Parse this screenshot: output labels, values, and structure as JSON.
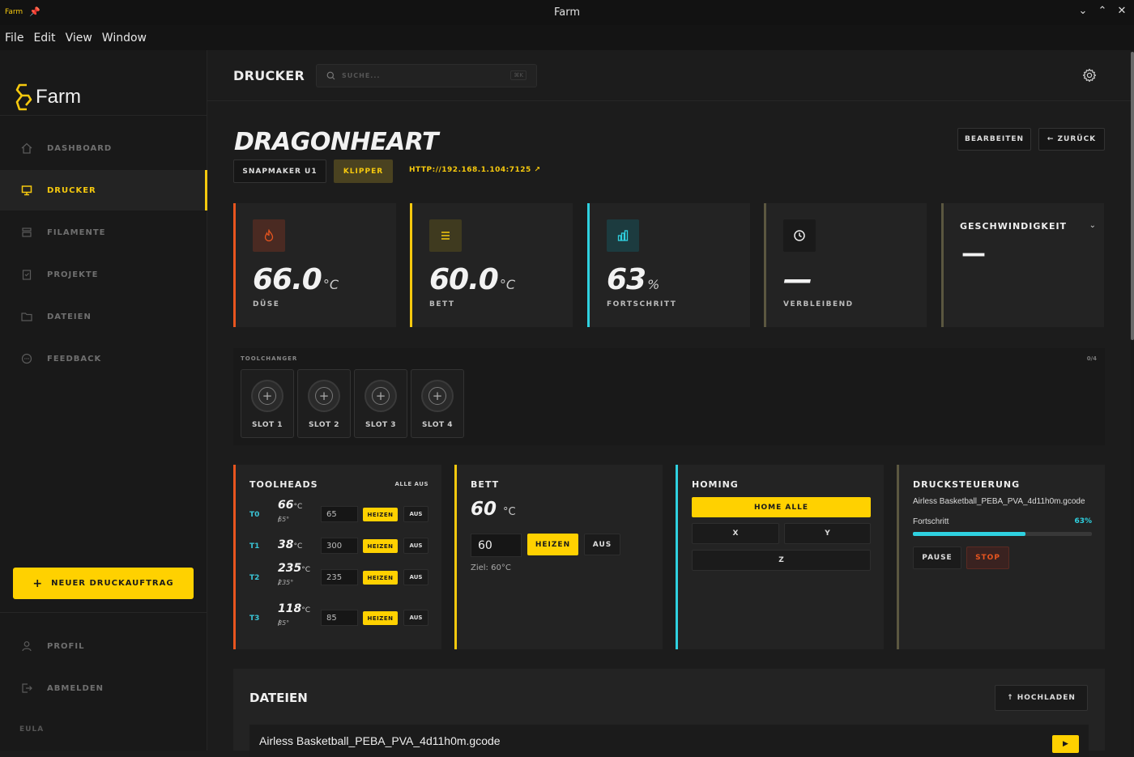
{
  "window": {
    "app_logo": "Farm",
    "title": "Farm",
    "controls": [
      "minimize",
      "maximize",
      "close"
    ]
  },
  "menu": [
    "File",
    "Edit",
    "View",
    "Window"
  ],
  "brand": {
    "name": "Farm"
  },
  "nav": [
    {
      "label": "DASHBOARD",
      "icon": "home-icon"
    },
    {
      "label": "DRUCKER",
      "icon": "monitor-icon",
      "active": true
    },
    {
      "label": "FILAMENTE",
      "icon": "layers-icon"
    },
    {
      "label": "PROJEKTE",
      "icon": "clipboard-icon"
    },
    {
      "label": "DATEIEN",
      "icon": "folder-icon"
    },
    {
      "label": "FEEDBACK",
      "icon": "chat-icon"
    }
  ],
  "new_job_label": "NEUER DRUCKAUFTRAG",
  "profile_label": "PROFIL",
  "logout_label": "ABMELDEN",
  "eula_label": "EULA",
  "header": {
    "title": "DRUCKER",
    "search_placeholder": "SUCHE...",
    "search_shortcut": "⌘K"
  },
  "printer": {
    "name": "DRAGONHEART",
    "model": "SNAPMAKER U1",
    "firmware": "KLIPPER",
    "url": "HTTP://192.168.1.104:7125",
    "edit_label": "BEARBEITEN",
    "back_label": "← ZURÜCK"
  },
  "stats": [
    {
      "value": "66.0",
      "unit": "°C",
      "label": "DÜSE",
      "color": "#e8551f"
    },
    {
      "value": "60.0",
      "unit": "°C",
      "label": "BETT",
      "color": "#f6c90e"
    },
    {
      "value": "63",
      "unit": "%",
      "label": "FORTSCHRITT",
      "color": "#2fd1e0"
    },
    {
      "value": "—",
      "unit": "",
      "label": "VERBLEIBEND",
      "color": "#5b5740"
    }
  ],
  "speed": {
    "title": "GESCHWINDIGKEIT",
    "value": "—"
  },
  "toolchanger": {
    "title": "TOOLCHANGER",
    "count": "0/4",
    "slots": [
      "SLOT 1",
      "SLOT 2",
      "SLOT 3",
      "SLOT 4"
    ]
  },
  "toolheads": {
    "title": "TOOLHEADS",
    "all_off": "ALLE AUS",
    "heat_label": "HEIZEN",
    "off_label": "AUS",
    "unit": "°C /",
    "rows": [
      {
        "id": "T0",
        "temp": "66",
        "target": "65°",
        "input": "65"
      },
      {
        "id": "T1",
        "temp": "38",
        "target": "",
        "input": "300"
      },
      {
        "id": "T2",
        "temp": "235",
        "target": "235°",
        "input": "235"
      },
      {
        "id": "T3",
        "temp": "118",
        "target": "85°",
        "input": "85"
      }
    ]
  },
  "bed_panel": {
    "title": "BETT",
    "temp": "60",
    "unit": "°C",
    "input": "60",
    "heat": "HEIZEN",
    "off": "AUS",
    "target": "Ziel: 60°C"
  },
  "homing": {
    "title": "HOMING",
    "home_all": "HOME ALLE",
    "x": "X",
    "y": "Y",
    "z": "Z"
  },
  "control": {
    "title": "DRUCKSTEUERUNG",
    "file": "Airless Basketball_PEBA_PVA_4d11h0m.gcode",
    "progress_label": "Fortschritt",
    "progress_text": "63%",
    "progress": 0.63,
    "pause": "PAUSE",
    "stop": "STOP"
  },
  "files": {
    "title": "DATEIEN",
    "upload": "↑ HOCHLADEN",
    "rows": [
      "Airless Basketball_PEBA_PVA_4d11h0m.gcode"
    ]
  }
}
